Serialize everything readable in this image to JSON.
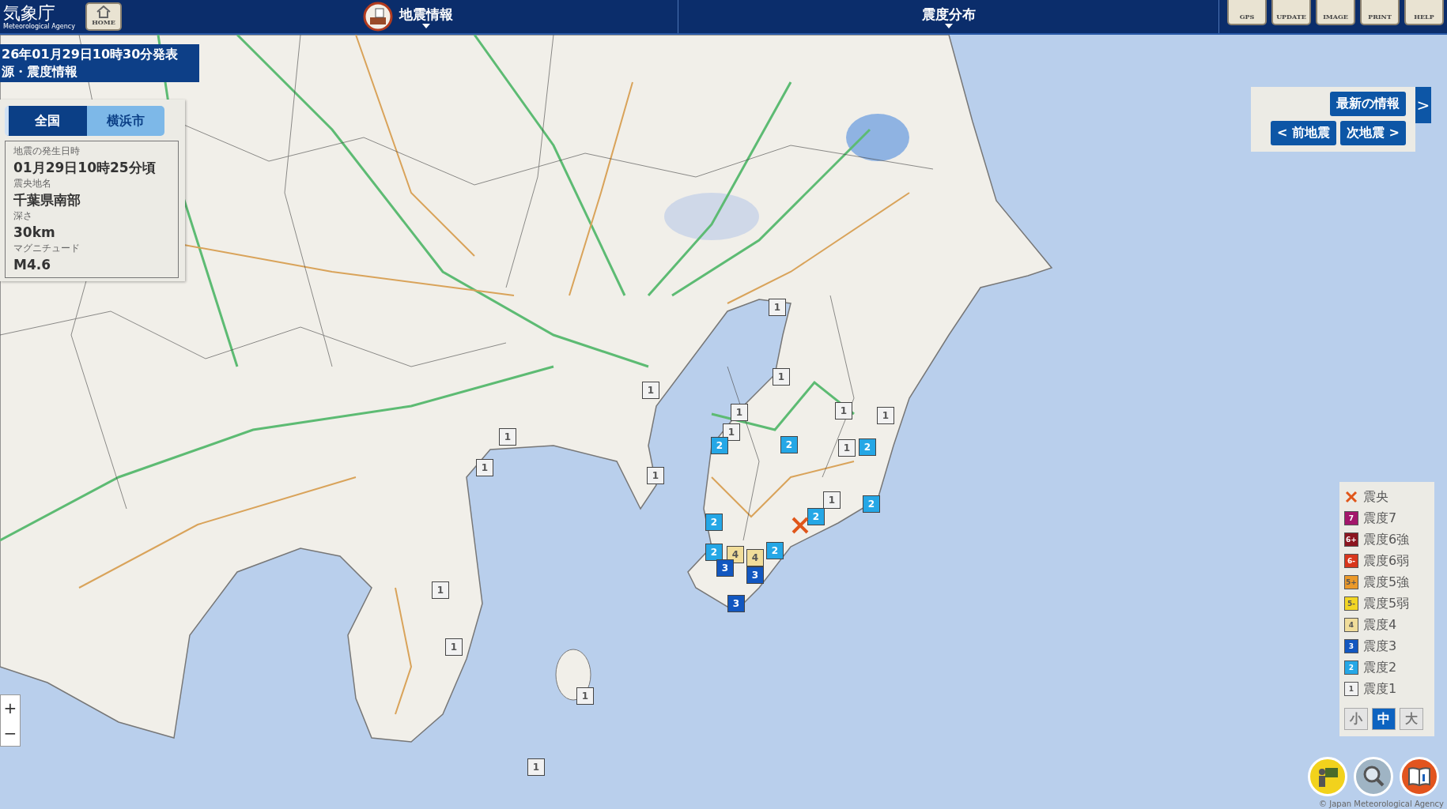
{
  "header": {
    "logo": "気象庁",
    "logo_sub": "Meteorological Agency",
    "home": "HOME",
    "menus": [
      "地震情報",
      "震度分布"
    ],
    "tools": [
      "GPS",
      "UPDATE",
      "IMAGE",
      "PRINT",
      "HELP"
    ]
  },
  "banner": {
    "line1": "26年01月29日10時30分発表",
    "line2": "源・震度情報"
  },
  "breadcrumb": [
    {
      "label": "全国",
      "selected": true
    },
    {
      "label": "横浜市",
      "selected": false
    }
  ],
  "quake": [
    {
      "label": "地震の発生日時",
      "value": "01月29日10時25分頃"
    },
    {
      "label": "震央地名",
      "value": "千葉県南部"
    },
    {
      "label": "深さ",
      "value": "30km"
    },
    {
      "label": "マグニチュード",
      "value": "M4.6"
    }
  ],
  "nav": {
    "latest": "最新の情報",
    "toggle": ">",
    "prev": "< 前地震",
    "next": "次地震 >"
  },
  "legend": [
    {
      "kind": "epicenter",
      "label": "震央",
      "color": "#e0561a"
    },
    {
      "kind": "intensity",
      "badge": "7",
      "label": "震度7",
      "color": "#a3166b"
    },
    {
      "kind": "intensity",
      "badge": "6+",
      "label": "震度6強",
      "color": "#8c1520"
    },
    {
      "kind": "intensity",
      "badge": "6-",
      "label": "震度6弱",
      "color": "#d8361c"
    },
    {
      "kind": "intensity",
      "badge": "5+",
      "label": "震度5強",
      "color": "#ec9a2a"
    },
    {
      "kind": "intensity",
      "badge": "5-",
      "label": "震度5弱",
      "color": "#f2d625"
    },
    {
      "kind": "intensity",
      "badge": "4",
      "label": "震度4",
      "color": "#f1dd9a"
    },
    {
      "kind": "intensity",
      "badge": "3",
      "label": "震度3",
      "color": "#1257c0"
    },
    {
      "kind": "intensity",
      "badge": "2",
      "label": "震度2",
      "color": "#25a7e6"
    },
    {
      "kind": "intensity",
      "badge": "1",
      "label": "震度1",
      "color": "#f2f2f2"
    }
  ],
  "sizes": [
    {
      "label": "小",
      "selected": false
    },
    {
      "label": "中",
      "selected": true
    },
    {
      "label": "大",
      "selected": false
    }
  ],
  "zoom": [
    "+",
    "−"
  ],
  "copyright": "© Japan Meteorological Agency",
  "markers": [
    {
      "label": "1",
      "color": "#f2f2f2"
    },
    {
      "label": "1",
      "color": "#f2f2f2"
    },
    {
      "label": "1",
      "color": "#f2f2f2"
    },
    {
      "label": "1",
      "color": "#f2f2f2"
    },
    {
      "label": "1",
      "color": "#f2f2f2"
    },
    {
      "label": "1",
      "color": "#f2f2f2"
    },
    {
      "label": "1",
      "color": "#f2f2f2"
    },
    {
      "label": "2",
      "color": "#25a7e6"
    },
    {
      "label": "2",
      "color": "#25a7e6"
    },
    {
      "label": "1",
      "color": "#f2f2f2"
    },
    {
      "label": "2",
      "color": "#25a7e6"
    },
    {
      "label": "1",
      "color": "#f2f2f2"
    },
    {
      "label": "1",
      "color": "#f2f2f2"
    },
    {
      "label": "1",
      "color": "#f2f2f2"
    },
    {
      "label": "1",
      "color": "#f2f2f2"
    },
    {
      "label": "2",
      "color": "#25a7e6"
    },
    {
      "label": "2",
      "color": "#25a7e6"
    },
    {
      "label": "2",
      "color": "#25a7e6"
    },
    {
      "label": "2",
      "color": "#25a7e6"
    },
    {
      "label": "4",
      "color": "#f1dd9a"
    },
    {
      "label": "4",
      "color": "#f1dd9a"
    },
    {
      "label": "2",
      "color": "#25a7e6"
    },
    {
      "label": "3",
      "color": "#1257c0"
    },
    {
      "label": "3",
      "color": "#1257c0"
    },
    {
      "label": "3",
      "color": "#1257c0"
    },
    {
      "label": "1",
      "color": "#f2f2f2"
    },
    {
      "label": "1",
      "color": "#f2f2f2"
    },
    {
      "label": "1",
      "color": "#f2f2f2"
    },
    {
      "label": "1",
      "color": "#f2f2f2"
    }
  ]
}
